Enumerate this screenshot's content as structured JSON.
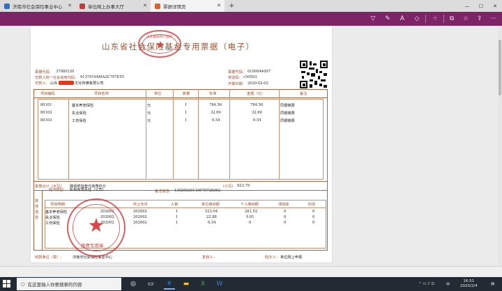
{
  "browser": {
    "tabs": [
      {
        "label": "济南市社会保险事业中心"
      },
      {
        "label": "单位网上办事大厅"
      },
      {
        "label": "票据详情页"
      }
    ]
  },
  "receipt": {
    "title": "山东省社会保险基金专用票据（电子）",
    "bill_code_label": "票据代码:",
    "bill_code": "37080120",
    "payer_credit_label": "交款人统一社会信用代码:",
    "payer_credit": "91370104MA3C797E55",
    "payer_label": "交款人:",
    "payer_name_prefix": "山东",
    "payer_name_suffix": "文化传媒有限公司",
    "bill_no_label": "票据号码:",
    "bill_no": "0100044007",
    "check_code_label": "校验码:",
    "check_code": "c50503",
    "issue_date_label": "开票日期:",
    "issue_date": "2020-02-02",
    "table_headers": [
      "项目编码",
      "项目名称",
      "单位",
      "数量",
      "标准",
      "金额（元）",
      "备注"
    ],
    "items": [
      {
        "code": "80101",
        "name": "基本养老保险",
        "unit": "元",
        "qty": "1",
        "std": "784.56",
        "amount": "784.56",
        "note": "同银缴费"
      },
      {
        "code": "80102",
        "name": "失业保险",
        "unit": "元",
        "qty": "1",
        "std": "32.69",
        "amount": "32.69",
        "note": "同银缴费"
      },
      {
        "code": "80103",
        "name": "工伤保险",
        "unit": "元",
        "qty": "1",
        "std": "6.54",
        "amount": "6.54",
        "note": "同银缴费"
      }
    ],
    "total_label": "金额合计（大写）",
    "total_words": "捌佰贰拾叁元柒角玖分",
    "total_small_label": "(小写)",
    "total_small": "823.79",
    "other_info_label": "其他信息",
    "econ_type_label": "经济类型:",
    "econ_type": "私有有限责任（公司）",
    "remark_label": "备注信息:",
    "remark": "13020020110079728362",
    "detail_headers": [
      "项目明细",
      "终止年月",
      "人数",
      "单位缴纳额",
      "个人缴纳额",
      "滞纳金",
      "利息"
    ],
    "details": [
      {
        "name": "基本养老保险",
        "end": "202002",
        "end2": "202002",
        "count": "1",
        "unit_pay": "523.04",
        "personal_pay": "261.52",
        "late": "0",
        "interest": "0"
      },
      {
        "name": "失业保险",
        "end": "202002",
        "end2": "202002",
        "count": "1",
        "unit_pay": "22.88",
        "personal_pay": "9.81",
        "late": "0",
        "interest": "0"
      },
      {
        "name": "工伤保险",
        "end": "202002",
        "end2": "202002",
        "count": "1",
        "unit_pay": "6.54",
        "personal_pay": "0",
        "late": "0",
        "interest": "0"
      }
    ],
    "collector_label": "收款单位（章）:",
    "collector": "济南市社会保险事业中心",
    "reviewer_label": "复核人:",
    "handler_label": "经办人:",
    "handler": "单位网上申报",
    "seal_top_text": "山东省财政厅监制",
    "seal_bottom_text": "缴费专用章"
  },
  "taskbar": {
    "search_placeholder": "在这里输入你要搜索的内容",
    "time": "16:51",
    "date": "2020/2/4",
    "ime": "中"
  },
  "colors": {
    "toolbar": "#7d2466",
    "receipt_brown": "#a4522e",
    "seal_red": "#d22828",
    "taskbar": "#222b33"
  }
}
